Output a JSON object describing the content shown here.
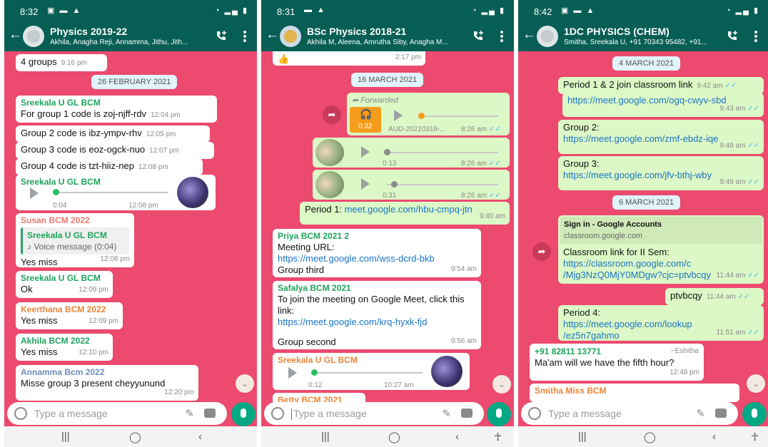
{
  "phones": [
    {
      "status": {
        "time": "8:32"
      },
      "header": {
        "title": "Physics 2019-22",
        "subtitle": "Akhila, Anagha Reji, Annamma, Jithu, Jith..."
      },
      "messages": {
        "m0": {
          "text": "4 groups",
          "time": "9:16 pm"
        },
        "date1": "26 FEBRUARY 2021",
        "m1": {
          "sender": "Sreekala U GL BCM",
          "text": "For group 1 code is zoj-njff-rdv",
          "time": "12:04 pm"
        },
        "m2": {
          "text": "Group 2 code is ibz-ympv-rhv",
          "time": "12:05 pm"
        },
        "m3": {
          "text": "Group 3 code is eoz-ogck-nuo",
          "time": "12:07 pm"
        },
        "m4": {
          "text": "Group 4 code is tzt-hiiz-nep",
          "time": "12:08 pm"
        },
        "m5": {
          "sender": "Sreekala U GL BCM",
          "duration": "0:04",
          "time": "12:08 pm"
        },
        "m6": {
          "sender": "Susan BCM 2022",
          "quote_sender": "Sreekala U GL BCM",
          "quote_text": "Voice message (0:04)",
          "text": "Yes miss",
          "time": "12:08 pm"
        },
        "m7": {
          "sender": "Sreekala U GL BCM",
          "text": "Ok",
          "time": "12:09 pm"
        },
        "m8": {
          "sender": "Keerthana BCM 2022",
          "text": "Yes miss",
          "time": "12:09 pm"
        },
        "m9": {
          "sender": "Akhila BCM 2022",
          "text": "Yes miss",
          "time": "12:10 pm"
        },
        "m10": {
          "sender": "Annamma Bcm 2022",
          "text": "Misse group 3 present cheyyunund",
          "time": "12:20 pm"
        }
      },
      "input": {
        "placeholder": "Type a message"
      }
    },
    {
      "status": {
        "time": "8:31"
      },
      "header": {
        "title": "BSc Physics 2018-21",
        "subtitle": "Akhila M, Aleena, Amrutha Siby, Anagha M..."
      },
      "messages": {
        "m0": {
          "time": "2:17 pm"
        },
        "date1": "16 MARCH 2021",
        "m1": {
          "forwarded": "Forwarded",
          "duration": "0:32",
          "file": "AUD-20210316-...",
          "time": "8:26 am"
        },
        "m2": {
          "duration": "0:13",
          "time": "8:26 am"
        },
        "m3": {
          "duration": "0:31",
          "time": "8:26 am"
        },
        "m4": {
          "prefix": "Period 1: ",
          "link": "meet.google.com/hbu-cmpq-jtn",
          "time": "9:40 am"
        },
        "m5": {
          "sender": "Priya BCM 2021 2",
          "line1": "Meeting URL:",
          "link": "https://meet.google.com/wss-dcrd-bkb",
          "line2": "Group third",
          "time": "9:54 am"
        },
        "m6": {
          "sender": "Safalya BCM 2021",
          "line1": "To join the meeting on Google Meet, click this link:",
          "link": "https://meet.google.com/krq-hyxk-fjd",
          "line2": "Group  second",
          "time": "9:56 am"
        },
        "m7": {
          "sender": "Sreekala U GL BCM",
          "duration": "0:12",
          "time": "10:27 am"
        },
        "m8": {
          "sender": "Betty BCM 2021"
        }
      },
      "input": {
        "placeholder": "Type a message"
      }
    },
    {
      "status": {
        "time": "8:42"
      },
      "header": {
        "title": "1DC PHYSICS (CHEM)",
        "subtitle": "Smitha, Sreekala U, +91 70343 95482, +91..."
      },
      "messages": {
        "date1": "4 MARCH 2021",
        "m1": {
          "text": "Period 1 & 2 join classroom link",
          "time": "9:42 am"
        },
        "m2": {
          "link": "https://meet.google.com/ogq-cwyv-sbd",
          "time": "9:43 am"
        },
        "m3": {
          "text": "Group 2:",
          "link": "https://meet.google.com/zmf-ebdz-iqe",
          "time": "9:48 am"
        },
        "m4": {
          "text": "Group 3:",
          "link": "https://meet.google.com/jfv-bthj-wby",
          "time": "9:49 am"
        },
        "date2": "6 MARCH 2021",
        "m5": {
          "preview_title": "Sign in - Google Accounts",
          "preview_domain": "classroom.google.com",
          "text": "Classroom link for II Sem:",
          "link1": "https://classroom.google.com/c",
          "link2": "/Mjg3NzQ0MjY0MDgw?cjc=ptvbcqy",
          "time": "11:44 am"
        },
        "m6": {
          "text": "ptvbcqy",
          "time": "11:44 am"
        },
        "m7": {
          "text": "Period 4:",
          "link1": "https://meet.google.com/lookup",
          "link2": "/ez5n7gahmo",
          "time": "11:51 am"
        },
        "m8": {
          "sender": "+91 82811 13771",
          "alias": "~Eshitha",
          "text": "Ma'am will we have the fifth hour?",
          "time": "12:48 pm"
        },
        "m9": {
          "sender": "Smitha Miss BCM"
        }
      },
      "input": {
        "placeholder": "Type a message"
      }
    }
  ],
  "colors": {
    "header": "#075e54",
    "chat_bg": "#ec4a6e",
    "outgoing": "#dcf8c6",
    "link": "#1a73c7"
  }
}
